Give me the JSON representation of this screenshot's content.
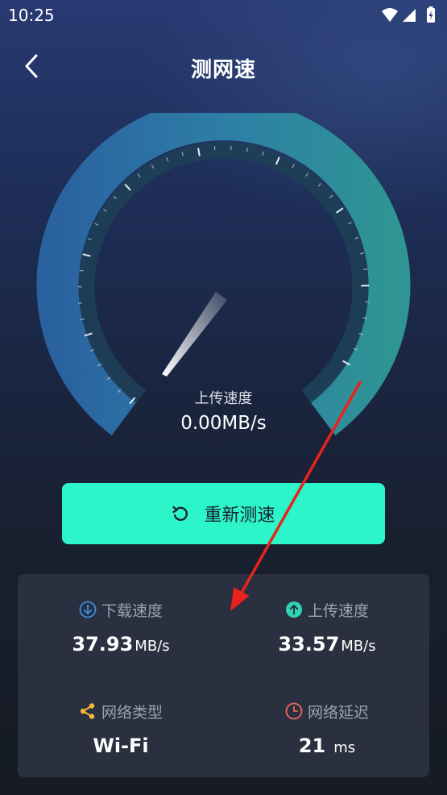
{
  "status_bar": {
    "time": "10:25",
    "icons": [
      "wifi-icon",
      "cellular-signal-icon",
      "battery-icon"
    ]
  },
  "header": {
    "title": "测网速",
    "back_icon": "chevron-left-icon"
  },
  "gauge": {
    "label": "上传速度",
    "value": "0.00MB/s",
    "needle_level": 0,
    "colors": {
      "outer_start": "#2a62a0",
      "outer_end": "#2e9494",
      "inner": "#1e3f58",
      "needle": "#ffffff"
    }
  },
  "retest": {
    "label": "重新测速",
    "icon": "refresh-icon",
    "color": "#2cf5c9"
  },
  "stats": {
    "download": {
      "label": "下载速度",
      "value": "37.93",
      "unit": "MB/s",
      "icon": "download-circle-icon",
      "color": "#3d8de6"
    },
    "upload": {
      "label": "上传速度",
      "value": "33.57",
      "unit": "MB/s",
      "icon": "upload-circle-icon",
      "color": "#2cd6b2"
    },
    "network_type": {
      "label": "网络类型",
      "value": "Wi-Fi",
      "icon": "share-nodes-icon",
      "color": "#f5b73a"
    },
    "latency": {
      "label": "网络延迟",
      "value": "21",
      "unit": "ms",
      "icon": "clock-icon",
      "color": "#f06a5c"
    }
  },
  "annotation": {
    "color": "#e8221c"
  }
}
